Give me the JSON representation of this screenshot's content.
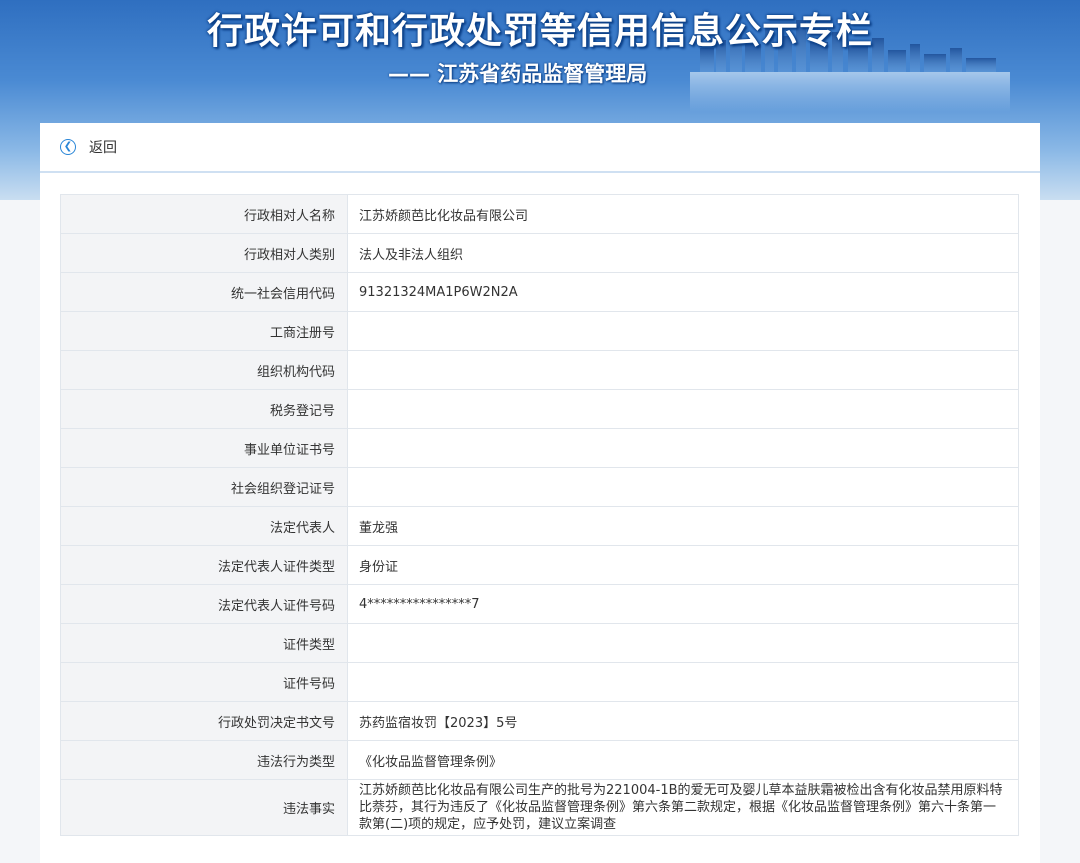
{
  "banner": {
    "title": "行政许可和行政处罚等信用信息公示专栏",
    "subtitle": "—— 江苏省药品监督管理局"
  },
  "nav": {
    "back_icon": "back-arrow-circle-icon",
    "back_label": "返回"
  },
  "fields": [
    {
      "label": "行政相对人名称",
      "value": "江苏娇颜芭比化妆品有限公司"
    },
    {
      "label": "行政相对人类别",
      "value": "法人及非法人组织"
    },
    {
      "label": "统一社会信用代码",
      "value": "91321324MA1P6W2N2A"
    },
    {
      "label": "工商注册号",
      "value": ""
    },
    {
      "label": "组织机构代码",
      "value": ""
    },
    {
      "label": "税务登记号",
      "value": ""
    },
    {
      "label": "事业单位证书号",
      "value": ""
    },
    {
      "label": "社会组织登记证号",
      "value": ""
    },
    {
      "label": "法定代表人",
      "value": "董龙强"
    },
    {
      "label": "法定代表人证件类型",
      "value": "身份证"
    },
    {
      "label": "法定代表人证件号码",
      "value": "4****************7"
    },
    {
      "label": "证件类型",
      "value": ""
    },
    {
      "label": "证件号码",
      "value": ""
    },
    {
      "label": "行政处罚决定书文号",
      "value": "苏药监宿妆罚【2023】5号"
    },
    {
      "label": "违法行为类型",
      "value": "《化妆品监督管理条例》"
    },
    {
      "label": "违法事实",
      "value": "江苏娇颜芭比化妆品有限公司生产的批号为221004-1B的爱无可及婴儿草本益肤霜被检出含有化妆品禁用原料特比萘芬，其行为违反了《化妆品监督管理条例》第六条第二款规定，根据《化妆品监督管理条例》第六十条第一款第(二)项的规定，应予处罚，建议立案调查"
    }
  ]
}
